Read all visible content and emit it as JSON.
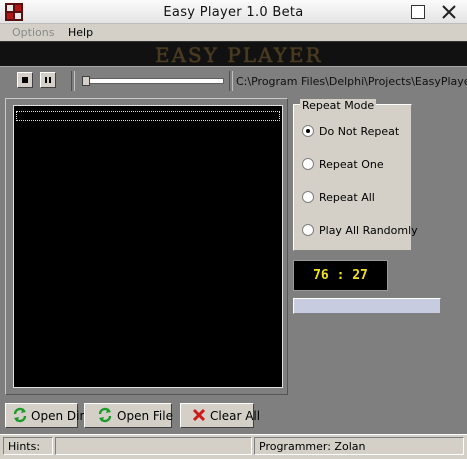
{
  "window": {
    "title": "Easy Player 1.0 Beta"
  },
  "menu": {
    "options": "Options",
    "help": "Help"
  },
  "banner": {
    "text": "EASY PLAYER"
  },
  "toolbar": {
    "path": "C:\\Program Files\\Delphi\\Projects\\EasyPlayer\\"
  },
  "repeat_mode": {
    "title": "Repeat Mode",
    "options": [
      "Do Not Repeat",
      "Repeat One",
      "Repeat All",
      "Play All Randomly"
    ],
    "selected": "Do Not Repeat"
  },
  "timer": {
    "display": "76 : 27"
  },
  "buttons": {
    "open_dir": "Open Dir..",
    "open_file": "Open File",
    "clear_all": "Clear All"
  },
  "status": {
    "hints_label": "Hints:",
    "hints_value": "",
    "programmer": "Programmer:  Zolan"
  },
  "colors": {
    "clock_text": "#f0e020",
    "banner_bg": "#111111",
    "panel_bg": "#d4d0c8",
    "volume_bg": "#c8cce0"
  }
}
